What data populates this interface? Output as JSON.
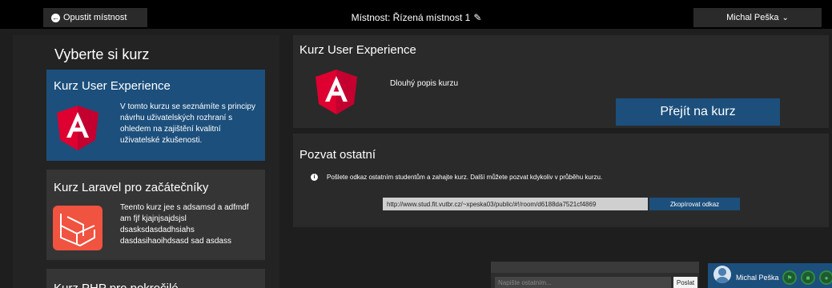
{
  "topbar": {
    "leave_label": "Opustit místnost",
    "room_title": "Místnost: Řízená místnost 1",
    "user_name": "Michal Peška"
  },
  "sidebar": {
    "title": "Vyberte si kurz",
    "courses": [
      {
        "title": "Kurz User Experience",
        "description": "V tomto kurzu se seznámíte s principy návrhu uživatelských rozhraní s ohledem na zajištění kvalitní uživatelské zkušenosti.",
        "logo": "angular-logo-icon",
        "selected": true
      },
      {
        "title": "Kurz Laravel pro začátečníky",
        "description": "Teento kurz jee s adsamsd a adfmdf am fjf kjajnjsajdsjsl dsasksdasdadhsiahs dasdasihaoihdsasd sad asdass",
        "logo": "laravel-logo-icon",
        "selected": false
      },
      {
        "title": "Kurz PHP pro pokročilé",
        "description": "",
        "logo": "",
        "selected": false
      }
    ]
  },
  "detail": {
    "title": "Kurz User Experience",
    "description": "Dlouhý popis kurzu",
    "go_label": "Přejít na kurz",
    "logo": "angular-logo-icon"
  },
  "invite": {
    "title": "Pozvat ostatní",
    "info": "Pošlete odkaz ostatním studentům a zahajte kurz. Další můžete pozvat kdykoliv v průběhu kurzu.",
    "link": "http://www.stud.fit.vutbr.cz/~xpeska03/public/#!/room/d6188da7521cf4869",
    "copy_label": "Zkopírovat odkaz"
  },
  "chat": {
    "placeholder": "Napište ostatním...",
    "send_label": "Poslat"
  },
  "user_card": {
    "name": "Michal Peška"
  },
  "colors": {
    "accent": "#1c4f7c",
    "background": "#1e1e1e",
    "panel": "#2a2a2a",
    "angular_red": "#dd0031",
    "laravel_red": "#f05340"
  }
}
